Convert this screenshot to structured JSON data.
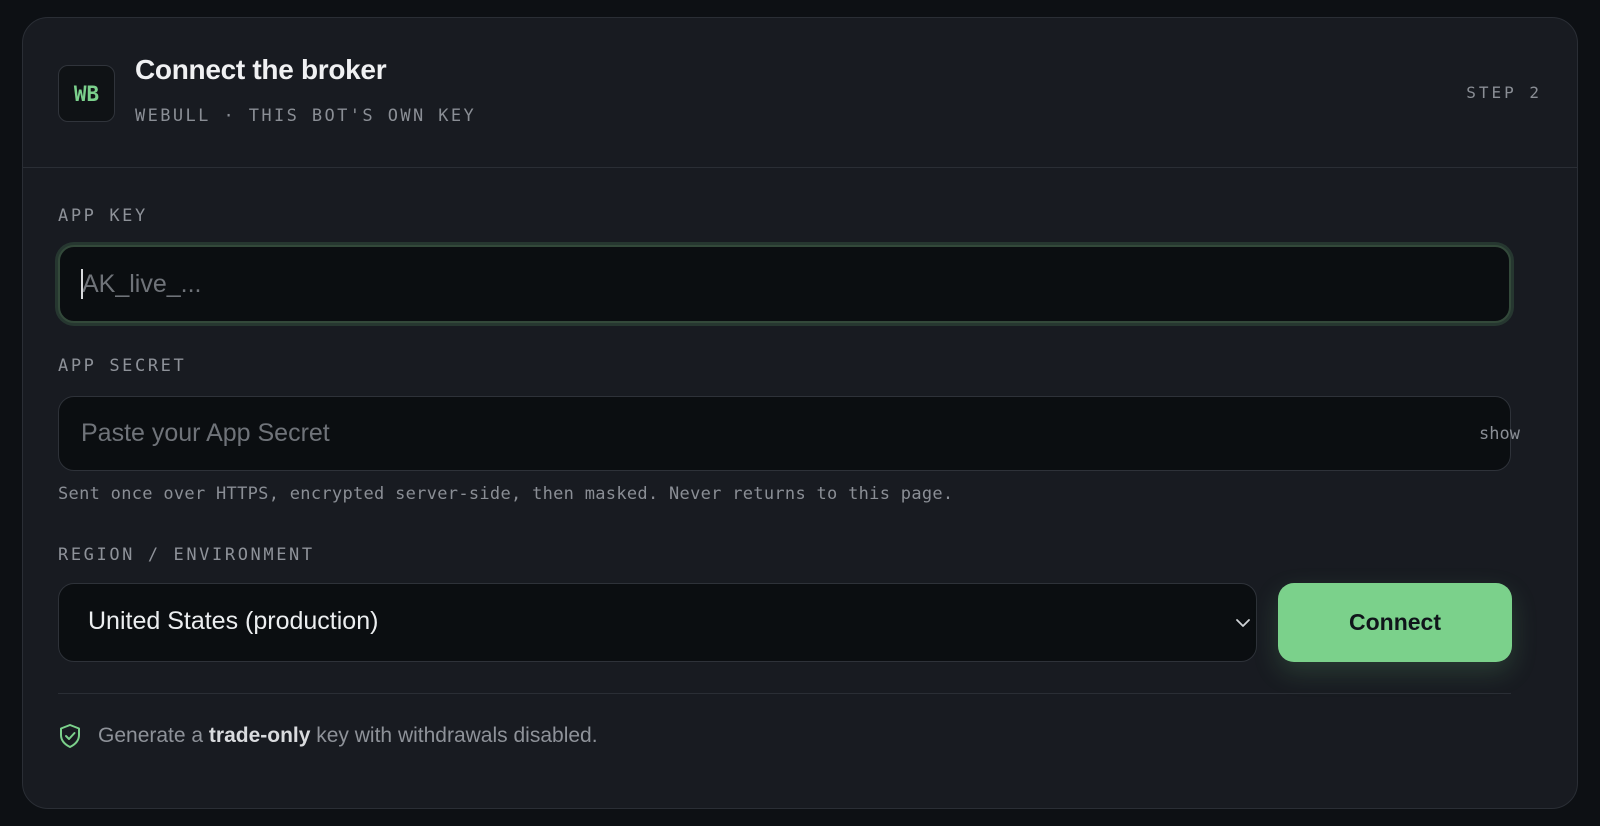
{
  "header": {
    "logo_text": "WB",
    "title": "Connect the broker",
    "subtitle": "WEBULL · THIS BOT'S OWN KEY",
    "step": "STEP 2"
  },
  "form": {
    "app_key": {
      "label": "APP KEY",
      "value": "",
      "placeholder": "AK_live_..."
    },
    "app_secret": {
      "label": "APP SECRET",
      "value": "",
      "placeholder": "Paste your App Secret",
      "toggle_label": "show",
      "hint": "Sent once over HTTPS, encrypted server-side, then masked. Never returns to this page."
    },
    "region": {
      "label": "REGION / ENVIRONMENT",
      "selected": "United States (production)"
    },
    "connect_label": "Connect"
  },
  "footer_note": {
    "icon": "shield-check-icon",
    "prefix": "Generate a ",
    "emphasis": "trade-only",
    "suffix": " key with withdrawals disabled."
  },
  "colors": {
    "accent": "#7bd18b",
    "background": "#0d1014",
    "card": "#181b21"
  }
}
